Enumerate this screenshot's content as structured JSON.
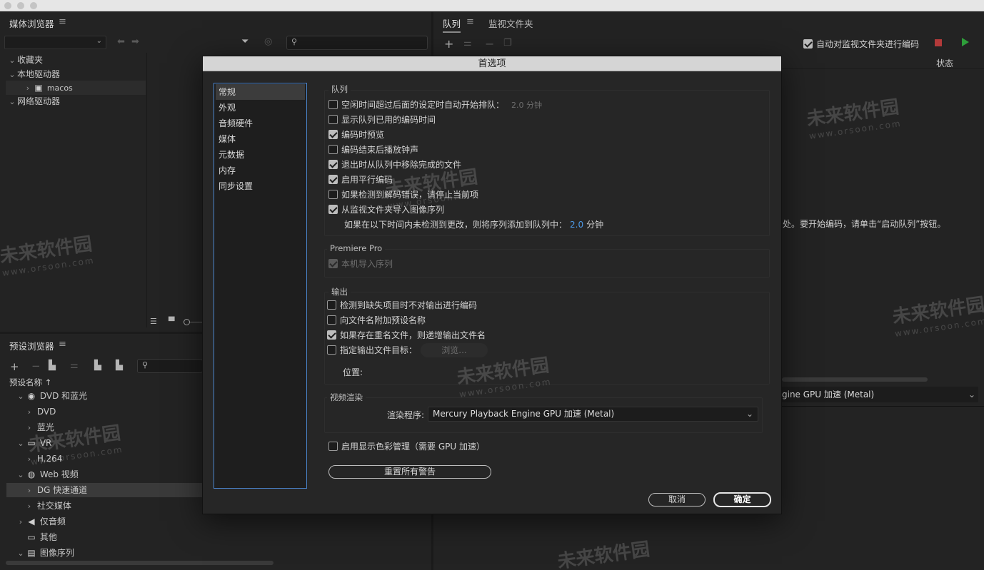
{
  "media_browser": {
    "title": "媒体浏览器",
    "tree": [
      {
        "label": "收藏夹"
      },
      {
        "label": "本地驱动器"
      },
      {
        "label": "macos"
      },
      {
        "label": "网络驱动器"
      }
    ]
  },
  "preset_browser": {
    "title": "预设浏览器",
    "column_header": "预设名称 ↑",
    "tree": [
      {
        "label": "DVD 和蓝光",
        "icon": "disc-icon"
      },
      {
        "label": "DVD"
      },
      {
        "label": "蓝光"
      },
      {
        "label": "VR",
        "icon": "vr-headset-icon"
      },
      {
        "label": "H.264"
      },
      {
        "label": "Web 视频",
        "icon": "globe-icon"
      },
      {
        "label": "DG 快速通道"
      },
      {
        "label": "社交媒体"
      },
      {
        "label": "仅音频",
        "icon": "speaker-icon"
      },
      {
        "label": "其他",
        "icon": "monitor-icon"
      },
      {
        "label": "图像序列",
        "icon": "image-sequence-icon"
      }
    ]
  },
  "queue_panel": {
    "tab_queue": "队列",
    "tab_watch": "监视文件夹",
    "auto_encode_label": "自动对监视文件夹进行编码",
    "status_header": "状态",
    "hint_text": "处。要开始编码，请单击“启动队列”按钮。",
    "renderer_partial": "gine GPU 加速 (Metal)"
  },
  "dialog": {
    "title": "首选项",
    "categories": [
      "常规",
      "外观",
      "音频硬件",
      "媒体",
      "元数据",
      "内存",
      "同步设置"
    ],
    "queue_group": {
      "label": "队列",
      "items": [
        {
          "label": "空闲时间超过后面的设定时自动开始排队：",
          "suffix": "2.0 分钟"
        },
        {
          "label": "显示队列已用的编码时间"
        },
        {
          "label": "编码时预览"
        },
        {
          "label": "编码结束后播放钟声"
        },
        {
          "label": "退出时从队列中移除完成的文件"
        },
        {
          "label": "启用平行编码"
        },
        {
          "label": "如果检测到解码错误，请停止当前项"
        },
        {
          "label": "从监视文件夹导入图像序列"
        }
      ],
      "sub_text": "如果在以下时间内未检测到更改，则将序列添加到队列中：",
      "sub_value": "2.0",
      "sub_unit": "分钟"
    },
    "premiere_group": {
      "label": "Premiere Pro",
      "item": "本机导入序列"
    },
    "output_group": {
      "label": "输出",
      "items": [
        {
          "label": "检测到缺失项目时不对输出进行编码"
        },
        {
          "label": "向文件名附加预设名称"
        },
        {
          "label": "如果存在重名文件，则递增输出文件名"
        },
        {
          "label": "指定输出文件目标："
        }
      ],
      "browse_label": "浏览...",
      "location_label": "位置:"
    },
    "render_group": {
      "label": "视频渲染",
      "renderer_label": "渲染程序:",
      "renderer_value": "Mercury Playback Engine GPU 加速 (Metal)"
    },
    "color_mgmt_label": "启用显示色彩管理（需要 GPU 加速）",
    "reset_warnings_label": "重置所有警告",
    "cancel_label": "取消",
    "ok_label": "确定"
  },
  "watermark": {
    "brand": "未来软件园",
    "url": "www.orsoon.com"
  },
  "colors": {
    "accent_blue": "#4d9ae8",
    "play_green": "#2e9e3a",
    "stop_red": "#b33a3a"
  }
}
